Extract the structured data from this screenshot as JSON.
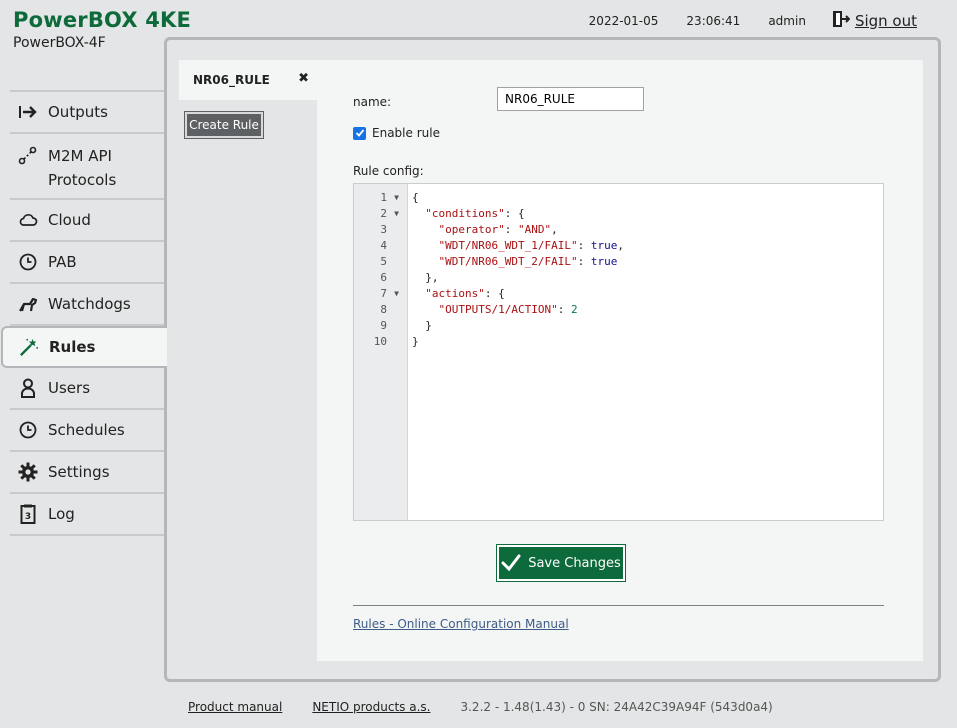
{
  "header": {
    "brand_title": "PowerBOX 4KE",
    "brand_subtitle": "PowerBOX-4F",
    "date": "2022-01-05",
    "time": "23:06:41",
    "user": "admin",
    "signout_label": "Sign out"
  },
  "sidebar": {
    "items": [
      {
        "label": "Outputs",
        "icon": "arrow-right-icon"
      },
      {
        "label": "M2M API Protocols",
        "line1": "M2M API",
        "line2": "Protocols",
        "icon": "m2m-icon"
      },
      {
        "label": "Cloud",
        "icon": "cloud-icon"
      },
      {
        "label": "PAB",
        "icon": "clock-icon"
      },
      {
        "label": "Watchdogs",
        "icon": "dog-icon"
      },
      {
        "label": "Rules",
        "icon": "magic-wand-icon"
      },
      {
        "label": "Users",
        "icon": "user-icon"
      },
      {
        "label": "Schedules",
        "icon": "clock-icon"
      },
      {
        "label": "Settings",
        "icon": "gear-icon"
      },
      {
        "label": "Log",
        "icon": "log-icon"
      }
    ],
    "active": "Rules"
  },
  "rules": {
    "tab_label": "NR06_RULE",
    "close_icon": "✖",
    "create_button": "Create Rule",
    "name_label": "name:",
    "name_value": "NR06_RULE",
    "enable_label": "Enable rule",
    "enable_checked": true,
    "config_label": "Rule config:",
    "line_numbers": [
      "1",
      "2",
      "3",
      "4",
      "5",
      "6",
      "7",
      "8",
      "9",
      "10"
    ],
    "code_lines": [
      "{",
      "  \"conditions\": {",
      "    \"operator\": \"AND\",",
      "    \"WDT/NR06_WDT_1/FAIL\": true,",
      "    \"WDT/NR06_WDT_2/FAIL\": true",
      "  },",
      "  \"actions\": {",
      "    \"OUTPUTS/1/ACTION\": 2",
      "  }",
      "}"
    ],
    "save_button": "Save Changes",
    "manual_link": "Rules - Online Configuration Manual"
  },
  "footer": {
    "product_manual": "Product manual",
    "company": "NETIO products a.s.",
    "version": "3.2.2 - 1.48(1.43) - 0 SN: 24A42C39A94F (543d0a4)"
  },
  "colors": {
    "brand_green": "#0d6a3a",
    "background": "#e4e5e6",
    "panel": "#f4f5f5",
    "link_blue": "#3e5c87"
  }
}
